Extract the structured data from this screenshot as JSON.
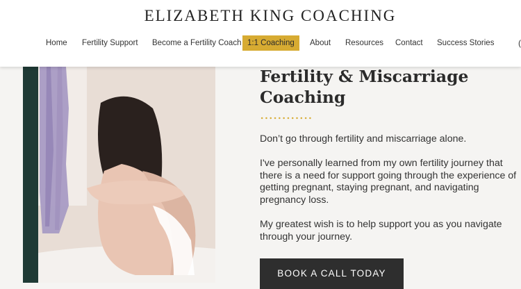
{
  "site": {
    "title": "ELIZABETH KING COACHING"
  },
  "nav": {
    "items": [
      {
        "label": "Home"
      },
      {
        "label": "Fertility Support"
      },
      {
        "label": "Become a Fertility Coach"
      },
      {
        "label": "1:1 Coaching"
      },
      {
        "label": "About"
      },
      {
        "label": "Resources"
      },
      {
        "label": "Contact"
      },
      {
        "label": "Success Stories"
      }
    ],
    "active_index": 3,
    "overflow_glyph": "("
  },
  "colors": {
    "accent": "#d7ab32",
    "dark_green": "#1f3a35",
    "button": "#2e2e2e",
    "page_bg": "#f5f4f2"
  },
  "main": {
    "heading_line1": "Fertility & Miscarriage",
    "heading_line2": "Coaching",
    "paragraph1": "Don’t go through fertility and miscarriage alone.",
    "paragraph2": "I've personally learned from my own fertility journey that there is a need for support going through the experience of getting pregnant, staying pregnant, and navigating pregnancy loss.",
    "paragraph3": "My greatest wish is to help support you as you navigate through your journey.",
    "cta_label": "BOOK A CALL TODAY"
  }
}
